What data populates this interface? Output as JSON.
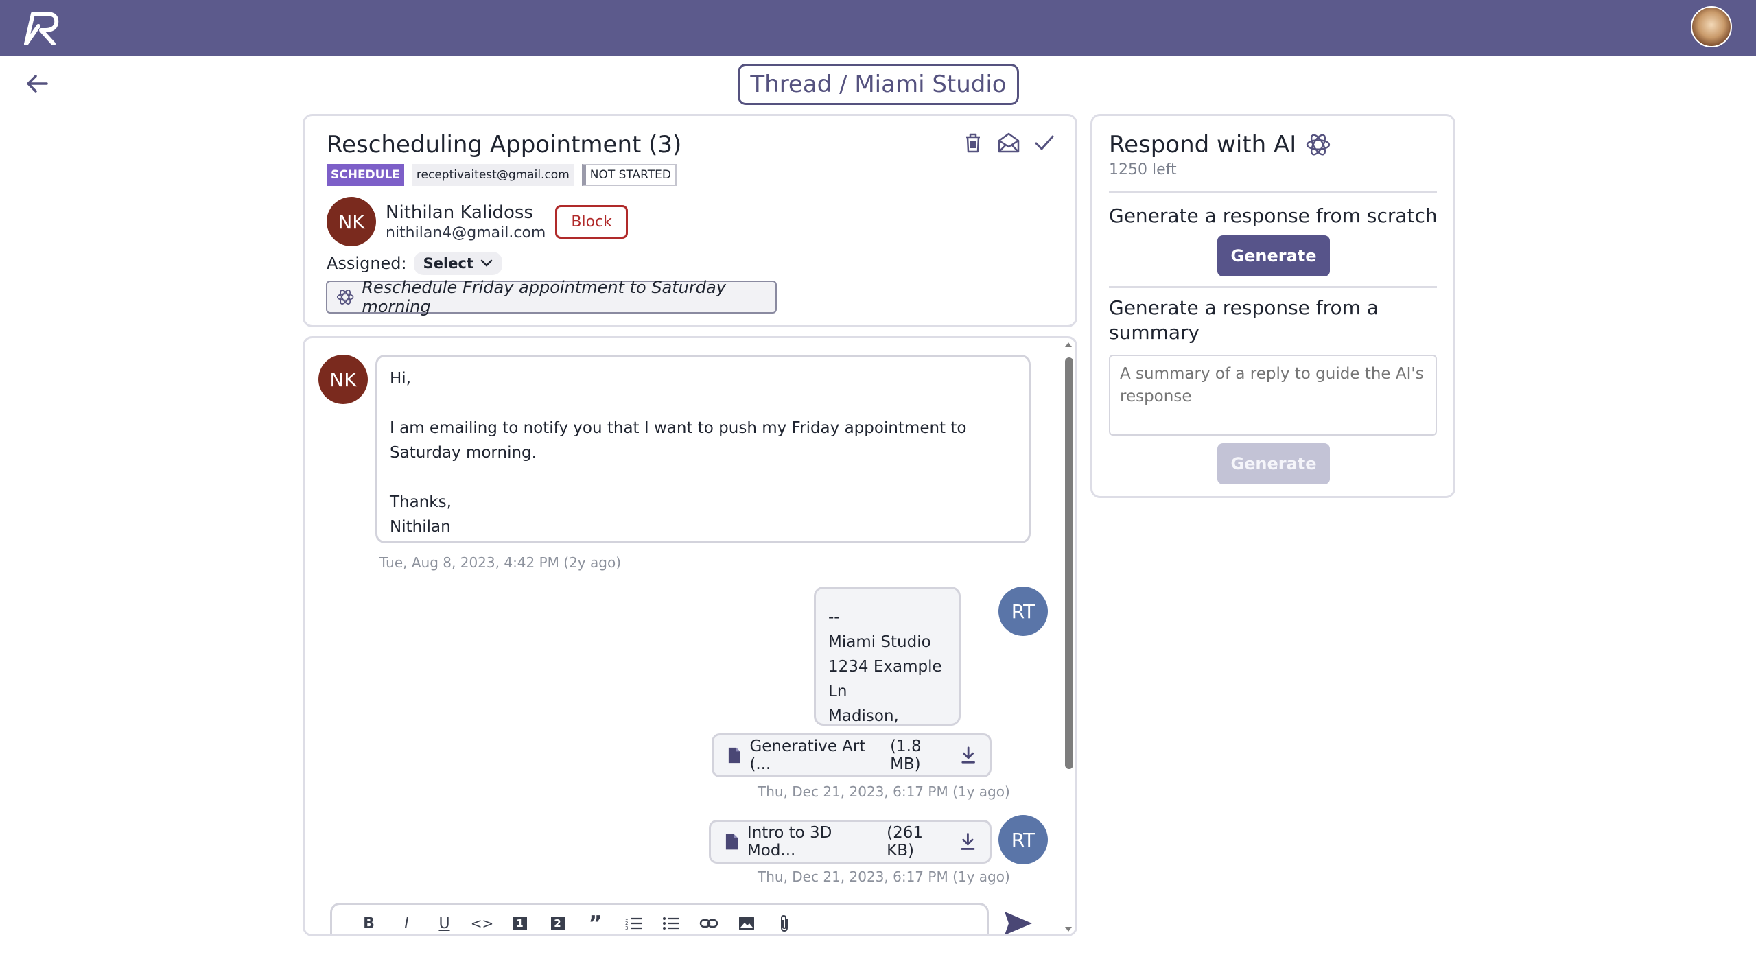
{
  "topbar": {
    "logo": "R",
    "user_avatar": "user-avatar"
  },
  "breadcrumb": "Thread / Miami Studio",
  "thread": {
    "subject": "Rescheduling Appointment (3)",
    "tags": {
      "category": "SCHEDULE",
      "inbox": "receptivaitest@gmail.com",
      "status": "NOT STARTED"
    },
    "sender": {
      "initials": "NK",
      "name": "Nithilan Kalidoss",
      "email": "nithilan4@gmail.com"
    },
    "block_label": "Block",
    "assigned_label": "Assigned:",
    "assigned_value": "Select",
    "ai_summary": "Reschedule Friday appointment to Saturday morning",
    "icons": [
      "trash-icon",
      "mail-open-icon",
      "check-icon"
    ]
  },
  "messages": {
    "incoming": {
      "initials": "NK",
      "lines": [
        "Hi,",
        "I am emailing to notify you that I want to push my Friday appointment to Saturday morning.",
        "Thanks,",
        "Nithilan"
      ],
      "timestamp": "Tue, Aug 8, 2023, 4:42 PM (2y ago)"
    },
    "outgoing": {
      "initials": "RT",
      "lines": [
        "--",
        "Miami Studio",
        "1234 Example Ln",
        "Madison, Wisconsin"
      ]
    },
    "attachments": [
      {
        "name": "Generative Art (...",
        "size": "(1.8 MB)",
        "timestamp": "Thu, Dec 21, 2023, 6:17 PM (1y ago)"
      },
      {
        "name": "Intro to 3D Mod...",
        "size": "(261 KB)",
        "timestamp": "Thu, Dec 21, 2023, 6:17 PM (1y ago)"
      }
    ],
    "attachment_owner_initials": "RT"
  },
  "editor": {
    "toolbar": [
      "B",
      "I",
      "U",
      "<>",
      "1",
      "2",
      "”",
      "ordered-list",
      "bullet-list",
      "link",
      "image",
      "attach"
    ]
  },
  "ai": {
    "title": "Respond with AI",
    "credits": "1250 left",
    "scratch_heading": "Generate a response from scratch",
    "generate_label": "Generate",
    "summary_heading": "Generate a response from a summary",
    "summary_placeholder": "A summary of a reply to guide the AI's response",
    "generate_label_2": "Generate"
  }
}
